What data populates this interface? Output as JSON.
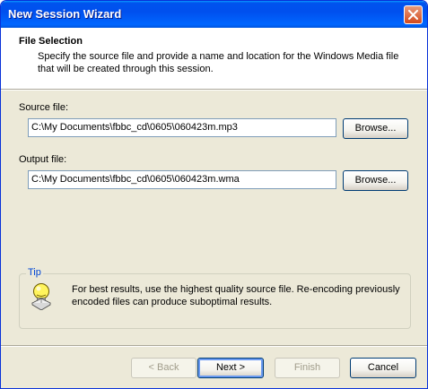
{
  "window": {
    "title": "New Session Wizard",
    "close_icon": "close-icon"
  },
  "header": {
    "title": "File Selection",
    "description": "Specify the source file and provide a name and location for the Windows Media file that will be created through this session."
  },
  "source": {
    "label": "Source file:",
    "value": "C:\\My Documents\\fbbc_cd\\0605\\060423m.mp3",
    "browse_label": "Browse..."
  },
  "output": {
    "label": "Output file:",
    "value": "C:\\My Documents\\fbbc_cd\\0605\\060423m.wma",
    "browse_label": "Browse..."
  },
  "tip": {
    "group_label": "Tip",
    "text": "For best results, use the highest quality source file. Re-encoding previously encoded files can produce suboptimal results.",
    "icon": "lightbulb-icon"
  },
  "footer": {
    "back_label": "< Back",
    "next_label": "Next >",
    "finish_label": "Finish",
    "cancel_label": "Cancel"
  },
  "colors": {
    "titlebar": "#0055ee",
    "dialog_bg": "#ece9d8",
    "tip_label": "#0046d5"
  }
}
